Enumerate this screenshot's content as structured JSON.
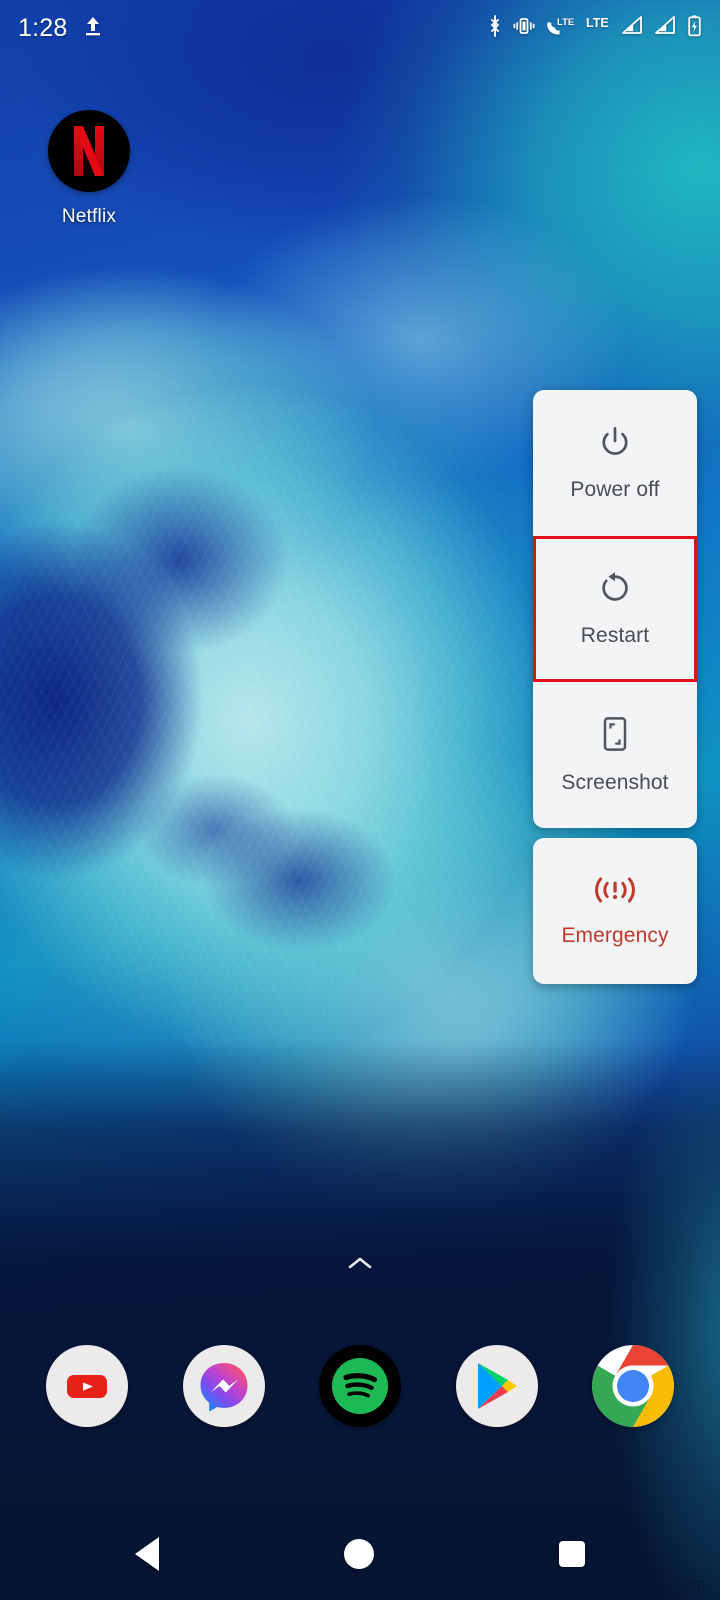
{
  "status_bar": {
    "time": "1:28",
    "left_icons": [
      {
        "name": "usb-upload-icon"
      }
    ],
    "right_icons": [
      {
        "name": "bluetooth-icon"
      },
      {
        "name": "vibrate-icon"
      },
      {
        "name": "volte-icon",
        "label": "LTE"
      },
      {
        "name": "lte-icon",
        "label": "LTE"
      },
      {
        "name": "signal-bars-sim1-icon"
      },
      {
        "name": "signal-bars-sim2-icon"
      },
      {
        "name": "battery-charging-icon"
      }
    ]
  },
  "home": {
    "apps": [
      {
        "name": "netflix",
        "label": "Netflix",
        "glyph": "N",
        "bg": "#000000",
        "fg": "#e50914"
      }
    ],
    "drawer_indicator": {
      "name": "chevron-up-icon"
    }
  },
  "power_menu": {
    "items": [
      {
        "id": "power-off",
        "label": "Power off",
        "icon": "power-icon",
        "highlighted": false
      },
      {
        "id": "restart",
        "label": "Restart",
        "icon": "restart-icon",
        "highlighted": true
      },
      {
        "id": "screenshot",
        "label": "Screenshot",
        "icon": "screenshot-icon",
        "highlighted": false
      }
    ],
    "emergency": {
      "id": "emergency",
      "label": "Emergency",
      "icon": "emergency-broadcast-icon",
      "color": "#c0392b"
    },
    "highlight_color": "#e0111a",
    "card_background": "#f3f4f6",
    "label_color": "#4a4d52"
  },
  "dock": {
    "apps": [
      {
        "name": "youtube",
        "label": "YouTube"
      },
      {
        "name": "messenger",
        "label": "Messenger"
      },
      {
        "name": "spotify",
        "label": "Spotify"
      },
      {
        "name": "play-store",
        "label": "Play Store"
      },
      {
        "name": "chrome",
        "label": "Chrome"
      }
    ]
  },
  "nav_bar": {
    "buttons": [
      {
        "name": "back-button",
        "label": "Back"
      },
      {
        "name": "home-button",
        "label": "Home"
      },
      {
        "name": "recents-button",
        "label": "Recents"
      }
    ]
  },
  "watermark": {
    "text": "wsxdn.com"
  }
}
